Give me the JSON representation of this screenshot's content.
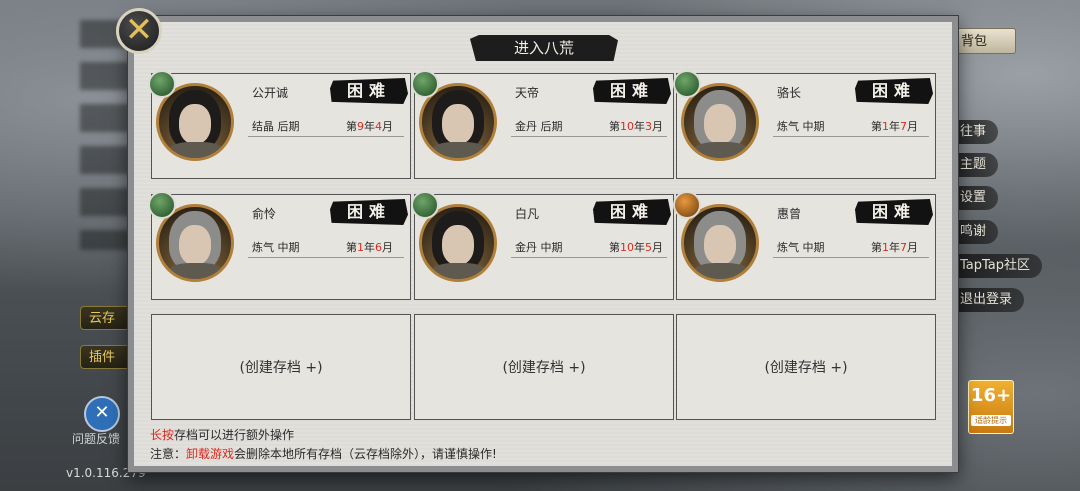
{
  "background": {
    "top_right_button": "背包",
    "side_menu": [
      "往事",
      "主题",
      "设置",
      "鸣谢",
      "TapTap社区",
      "退出登录"
    ],
    "left_pills": [
      "云存",
      "插件"
    ],
    "tool_label": "问题反馈",
    "version": "v1.0.116.279",
    "age_rating": {
      "number": "16+",
      "subtitle": "适龄提示"
    }
  },
  "dialog": {
    "title": "进入八荒",
    "close_icon": "close-x-icon",
    "slots": [
      {
        "name": "公开诚",
        "difficulty": "困难",
        "stage": "结晶 后期",
        "time_prefix": "第",
        "year": "9",
        "year_unit": "年",
        "month": "4",
        "month_unit": "月",
        "badge": "jade-badge-icon"
      },
      {
        "name": "天帝",
        "difficulty": "困难",
        "stage": "金丹 后期",
        "time_prefix": "第",
        "year": "10",
        "year_unit": "年",
        "month": "3",
        "month_unit": "月",
        "badge": "jade-badge-icon"
      },
      {
        "name": "骆长",
        "difficulty": "困难",
        "stage": "炼气 中期",
        "time_prefix": "第",
        "year": "1",
        "year_unit": "年",
        "month": "7",
        "month_unit": "月",
        "badge": "jade-badge-icon"
      },
      {
        "name": "俞怜",
        "difficulty": "困难",
        "stage": "炼气 中期",
        "time_prefix": "第",
        "year": "1",
        "year_unit": "年",
        "month": "6",
        "month_unit": "月",
        "badge": "jade-badge-icon"
      },
      {
        "name": "白凡",
        "difficulty": "困难",
        "stage": "金丹 中期",
        "time_prefix": "第",
        "year": "10",
        "year_unit": "年",
        "month": "5",
        "month_unit": "月",
        "badge": "jade-badge-icon"
      },
      {
        "name": "惠曾",
        "difficulty": "困难",
        "stage": "炼气 中期",
        "time_prefix": "第",
        "year": "1",
        "year_unit": "年",
        "month": "7",
        "month_unit": "月",
        "badge": "orange-badge-icon"
      }
    ],
    "empty_slots": [
      "(创建存档 +)",
      "(创建存档 +)",
      "(创建存档 +)"
    ],
    "hint_long_press": {
      "highlight": "长按",
      "rest": "存档可以进行额外操作"
    },
    "hint_uninstall": {
      "prefix": "注意：",
      "highlight": "卸载游戏",
      "rest": "会删除本地所有存档（云存档除外），请谨慎操作!"
    }
  },
  "colors": {
    "accent_red": "#d92a1e",
    "panel_bg": "#e2e0db",
    "gold": "#b0803a"
  }
}
